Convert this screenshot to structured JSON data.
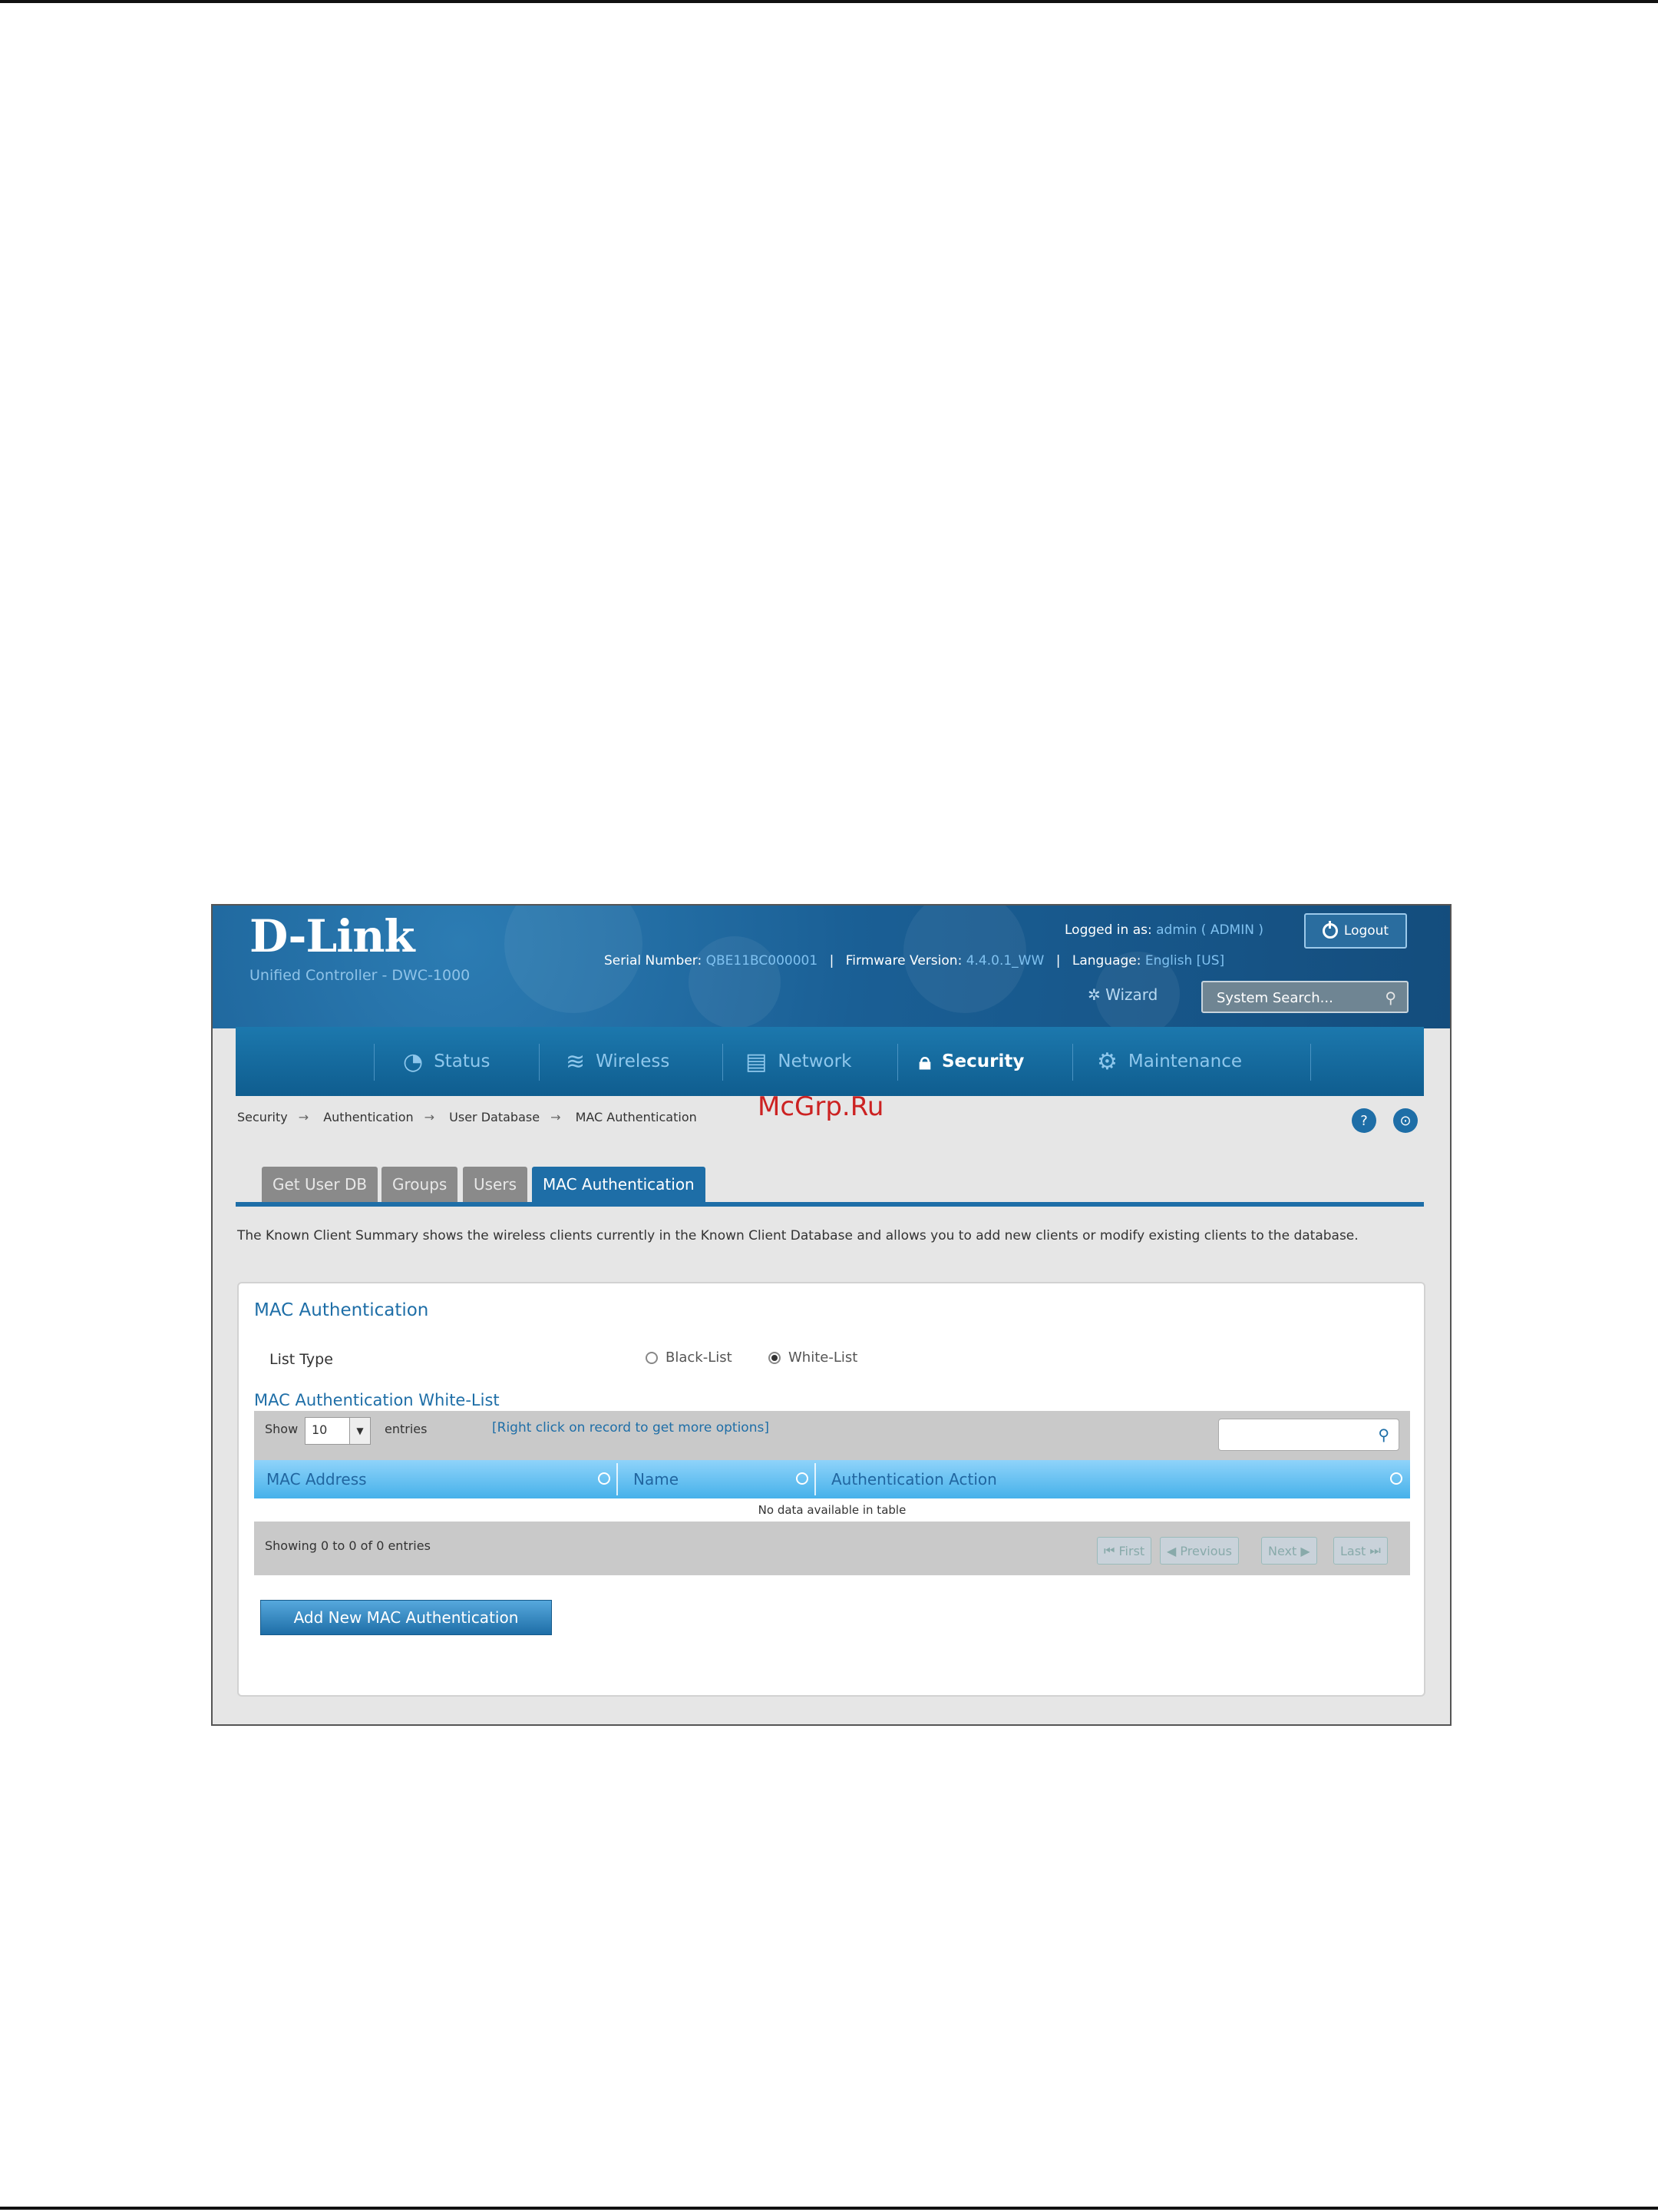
{
  "header": {
    "logo": "D-Link",
    "logo_sub": "Unified Controller - DWC-1000",
    "logged_in_label": "Logged in as:",
    "logged_in_user": "admin ( ADMIN )",
    "logout_label": "Logout",
    "serial_label": "Serial Number:",
    "serial_value": "QBE11BC000001",
    "firmware_label": "Firmware Version:",
    "firmware_value": "4.4.0.1_WW",
    "language_label": "Language:",
    "language_value": "English [US]",
    "wizard_label": "Wizard",
    "search_placeholder": "System Search..."
  },
  "nav": {
    "items": [
      {
        "label": "Status",
        "icon": "gauge-icon"
      },
      {
        "label": "Wireless",
        "icon": "wifi-icon"
      },
      {
        "label": "Network",
        "icon": "network-icon"
      },
      {
        "label": "Security",
        "icon": "lock-icon",
        "active": true
      },
      {
        "label": "Maintenance",
        "icon": "gears-icon"
      }
    ]
  },
  "breadcrumb": [
    "Security",
    "Authentication",
    "User Database",
    "MAC Authentication"
  ],
  "watermark": "McGrp.Ru",
  "tabs": [
    "Get User DB",
    "Groups",
    "Users",
    "MAC Authentication"
  ],
  "description": "The Known Client Summary shows the wireless clients currently in the Known Client Database and allows you to add new clients or modify existing clients to the database.",
  "panel": {
    "title": "MAC Authentication",
    "list_type_label": "List Type",
    "radio_black": "Black-List",
    "radio_white": "White-List",
    "selected": "White-List",
    "subtitle": "MAC Authentication White-List",
    "show_label": "Show",
    "show_value": "10",
    "entries_label": "entries",
    "hint": "[Right click on record to get more options]",
    "columns": [
      "MAC Address",
      "Name",
      "Authentication Action"
    ],
    "empty_text": "No data available in table",
    "showing_text": "Showing 0 to 0 of 0 entries",
    "pager": [
      "First",
      "Previous",
      "Next",
      "Last"
    ],
    "add_button": "Add New MAC Authentication"
  },
  "colors": {
    "brand_blue": "#1e6ea7",
    "header_blue": "#144d7d",
    "watermark": "#cc2222"
  }
}
